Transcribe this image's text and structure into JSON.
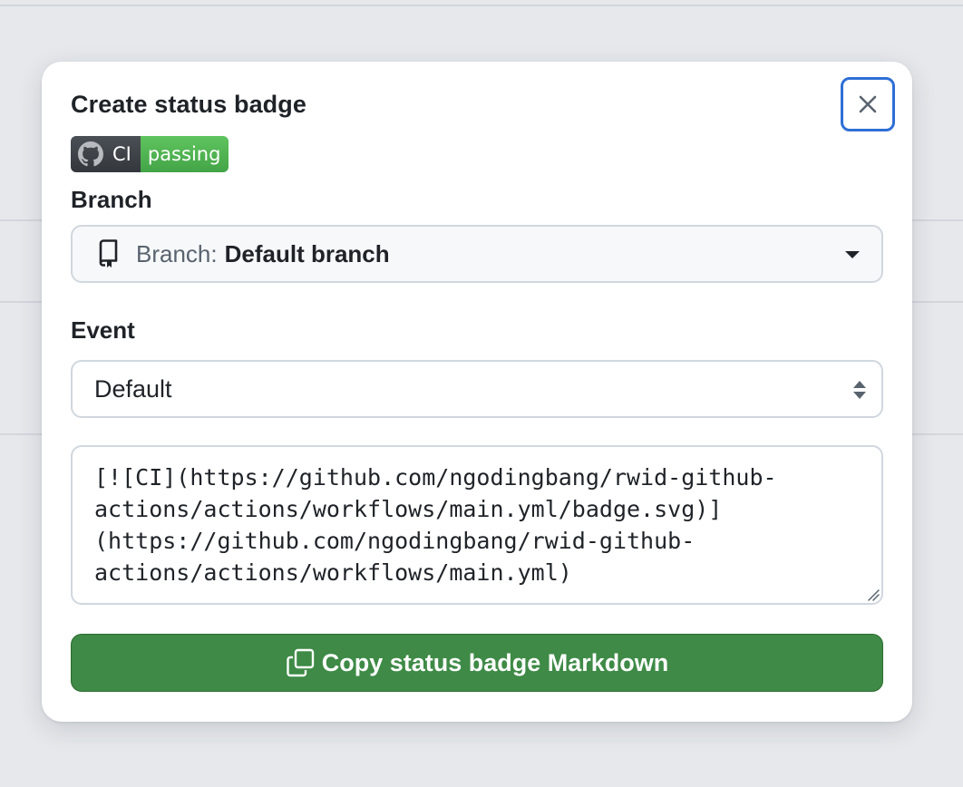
{
  "dialog": {
    "title": "Create status badge",
    "close_icon": "x-icon"
  },
  "badge": {
    "icon": "github-mark-icon",
    "label": "CI",
    "status": "passing",
    "colors": {
      "label_bg": "#3f4449",
      "status_bg": "#4fb351"
    }
  },
  "branch": {
    "section_label": "Branch",
    "prefix": "Branch:",
    "value": "Default branch",
    "icon": "repo-icon"
  },
  "event": {
    "section_label": "Event",
    "selected": "Default"
  },
  "markdown": {
    "lines": [
      "[![CI](https://github.com/ngodingbang/rwid-github-",
      "actions/actions/workflows/main.yml/badge.svg)]",
      "(https://github.com/ngodingbang/rwid-github-",
      "actions/actions/workflows/main.yml)"
    ]
  },
  "copy_button": {
    "label": "Copy status badge Markdown",
    "icon": "copy-icon",
    "color": "#3e8a46"
  },
  "colors": {
    "focus_ring": "#2f6fd6",
    "backdrop": "#e6e8ec"
  }
}
